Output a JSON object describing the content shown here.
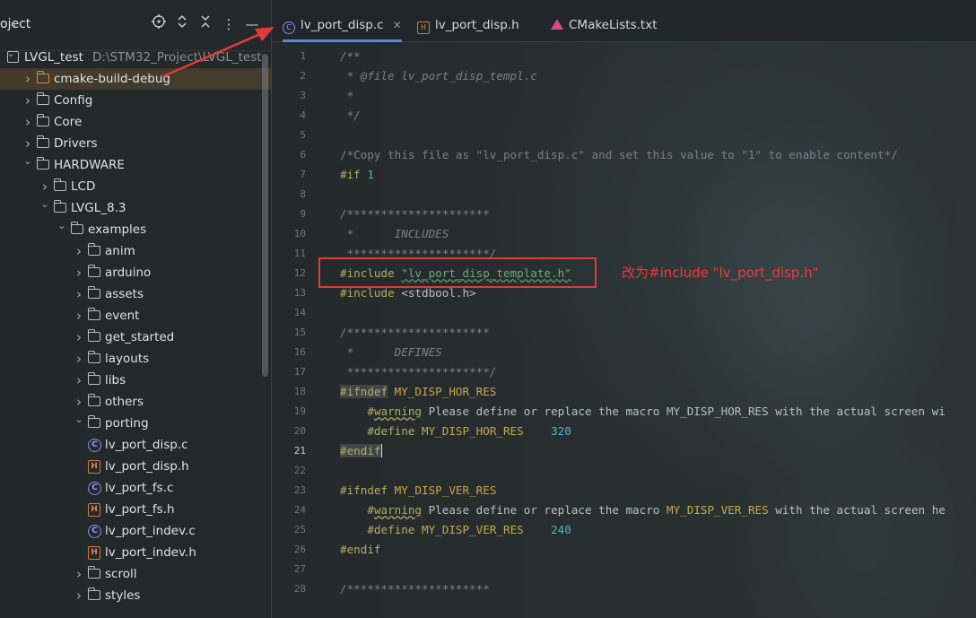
{
  "sidebar": {
    "header_label": "oject",
    "header_icons": [
      "target-icon",
      "expand-collapse-icon",
      "collapse-all-icon",
      "more-icon",
      "minimize-icon"
    ],
    "tree": [
      {
        "depth": 0,
        "label": "LVGL_test",
        "path": "D:\\STM32_Project\\LVGL_test",
        "kind": "project",
        "expanded": true
      },
      {
        "depth": 1,
        "label": "cmake-build-debug",
        "kind": "folder-orange",
        "expanded": false,
        "selected": true
      },
      {
        "depth": 1,
        "label": "Config",
        "kind": "folder",
        "expanded": false
      },
      {
        "depth": 1,
        "label": "Core",
        "kind": "folder",
        "expanded": false
      },
      {
        "depth": 1,
        "label": "Drivers",
        "kind": "folder",
        "expanded": false
      },
      {
        "depth": 1,
        "label": "HARDWARE",
        "kind": "folder",
        "expanded": true
      },
      {
        "depth": 2,
        "label": "LCD",
        "kind": "folder",
        "expanded": false
      },
      {
        "depth": 2,
        "label": "LVGL_8.3",
        "kind": "folder",
        "expanded": true
      },
      {
        "depth": 3,
        "label": "examples",
        "kind": "folder",
        "expanded": true
      },
      {
        "depth": 4,
        "label": "anim",
        "kind": "folder",
        "expanded": false
      },
      {
        "depth": 4,
        "label": "arduino",
        "kind": "folder",
        "expanded": false
      },
      {
        "depth": 4,
        "label": "assets",
        "kind": "folder",
        "expanded": false
      },
      {
        "depth": 4,
        "label": "event",
        "kind": "folder",
        "expanded": false
      },
      {
        "depth": 4,
        "label": "get_started",
        "kind": "folder",
        "expanded": false
      },
      {
        "depth": 4,
        "label": "layouts",
        "kind": "folder",
        "expanded": false
      },
      {
        "depth": 4,
        "label": "libs",
        "kind": "folder",
        "expanded": false
      },
      {
        "depth": 4,
        "label": "others",
        "kind": "folder",
        "expanded": false
      },
      {
        "depth": 4,
        "label": "porting",
        "kind": "folder",
        "expanded": true
      },
      {
        "depth": 5,
        "label": "lv_port_disp.c",
        "kind": "c"
      },
      {
        "depth": 5,
        "label": "lv_port_disp.h",
        "kind": "h"
      },
      {
        "depth": 5,
        "label": "lv_port_fs.c",
        "kind": "c"
      },
      {
        "depth": 5,
        "label": "lv_port_fs.h",
        "kind": "h"
      },
      {
        "depth": 5,
        "label": "lv_port_indev.c",
        "kind": "c"
      },
      {
        "depth": 5,
        "label": "lv_port_indev.h",
        "kind": "h"
      },
      {
        "depth": 4,
        "label": "scroll",
        "kind": "folder",
        "expanded": false
      },
      {
        "depth": 4,
        "label": "styles",
        "kind": "folder",
        "expanded": false
      }
    ]
  },
  "tabs": [
    {
      "label": "lv_port_disp.c",
      "icon": "c",
      "active": true,
      "closable": true
    },
    {
      "label": "lv_port_disp.h",
      "icon": "h",
      "active": false
    },
    {
      "label": "CMakeLists.txt",
      "icon": "cmake",
      "active": false
    }
  ],
  "editor": {
    "current_line": 21,
    "lines": [
      {
        "n": 1,
        "segs": [
          [
            "cm",
            "/**"
          ]
        ]
      },
      {
        "n": 2,
        "segs": [
          [
            "cm",
            " * @file lv_port_disp_templ.c"
          ]
        ]
      },
      {
        "n": 3,
        "segs": [
          [
            "cm",
            " *"
          ]
        ]
      },
      {
        "n": 4,
        "segs": [
          [
            "cm",
            " */"
          ]
        ]
      },
      {
        "n": 5,
        "segs": []
      },
      {
        "n": 6,
        "segs": [
          [
            "cmn",
            "/*Copy this file as \"lv_port_disp.c\" and set this value to \"1\" to enable content*/"
          ]
        ]
      },
      {
        "n": 7,
        "segs": [
          [
            "kw",
            "#if "
          ],
          [
            "num",
            "1"
          ]
        ]
      },
      {
        "n": 8,
        "segs": []
      },
      {
        "n": 9,
        "segs": [
          [
            "cm",
            "/*********************"
          ]
        ]
      },
      {
        "n": 10,
        "segs": [
          [
            "cm",
            " *      INCLUDES"
          ]
        ]
      },
      {
        "n": 11,
        "segs": [
          [
            "cm",
            " *********************/"
          ]
        ]
      },
      {
        "n": 12,
        "segs": [
          [
            "kw",
            "#include "
          ],
          [
            "str sqw",
            "\"lv_port_disp_template.h\""
          ]
        ]
      },
      {
        "n": 13,
        "segs": [
          [
            "kw",
            "#include "
          ],
          [
            "plain",
            "<stdbool.h>"
          ]
        ]
      },
      {
        "n": 14,
        "segs": []
      },
      {
        "n": 15,
        "segs": [
          [
            "cm",
            "/*********************"
          ]
        ]
      },
      {
        "n": 16,
        "segs": [
          [
            "cm",
            " *      DEFINES"
          ]
        ]
      },
      {
        "n": 17,
        "segs": [
          [
            "cm",
            " *********************/"
          ]
        ]
      },
      {
        "n": 18,
        "segs": [
          [
            "kw hl",
            "#ifndef"
          ],
          [
            "mac",
            " MY_DISP_HOR_RES"
          ]
        ]
      },
      {
        "n": 19,
        "segs": [
          [
            "plain",
            "    "
          ],
          [
            "kw",
            "#"
          ],
          [
            "warnw",
            "warning"
          ],
          [
            "plain",
            " Please define or replace the macro MY_DISP_HOR_RES with the actual screen wi"
          ]
        ]
      },
      {
        "n": 20,
        "segs": [
          [
            "plain",
            "    "
          ],
          [
            "kw",
            "#define "
          ],
          [
            "mac",
            "MY_DISP_HOR_RES"
          ],
          [
            "plain",
            "    "
          ],
          [
            "num",
            "320"
          ]
        ]
      },
      {
        "n": 21,
        "segs": [
          [
            "kw hl",
            "#endif"
          ],
          [
            "caret",
            ""
          ]
        ]
      },
      {
        "n": 22,
        "segs": []
      },
      {
        "n": 23,
        "segs": [
          [
            "kw",
            "#ifndef "
          ],
          [
            "mac",
            "MY_DISP_VER_RES"
          ]
        ]
      },
      {
        "n": 24,
        "segs": [
          [
            "plain",
            "    "
          ],
          [
            "kw",
            "#"
          ],
          [
            "warnw",
            "warning"
          ],
          [
            "plain",
            " Please define or replace the macro "
          ],
          [
            "mac",
            "MY_DISP_VER_RES"
          ],
          [
            "plain",
            " with the actual screen he"
          ]
        ]
      },
      {
        "n": 25,
        "segs": [
          [
            "plain",
            "    "
          ],
          [
            "kw",
            "#define "
          ],
          [
            "mac",
            "MY_DISP_VER_RES"
          ],
          [
            "plain",
            "    "
          ],
          [
            "num",
            "240"
          ]
        ]
      },
      {
        "n": 26,
        "segs": [
          [
            "kw",
            "#endif"
          ]
        ]
      },
      {
        "n": 27,
        "segs": []
      },
      {
        "n": 28,
        "segs": [
          [
            "cm",
            "/*********************"
          ]
        ]
      }
    ]
  },
  "annotation": {
    "text": "改为#include \"lv_port_disp.h\"",
    "color": "#e23a3a"
  }
}
